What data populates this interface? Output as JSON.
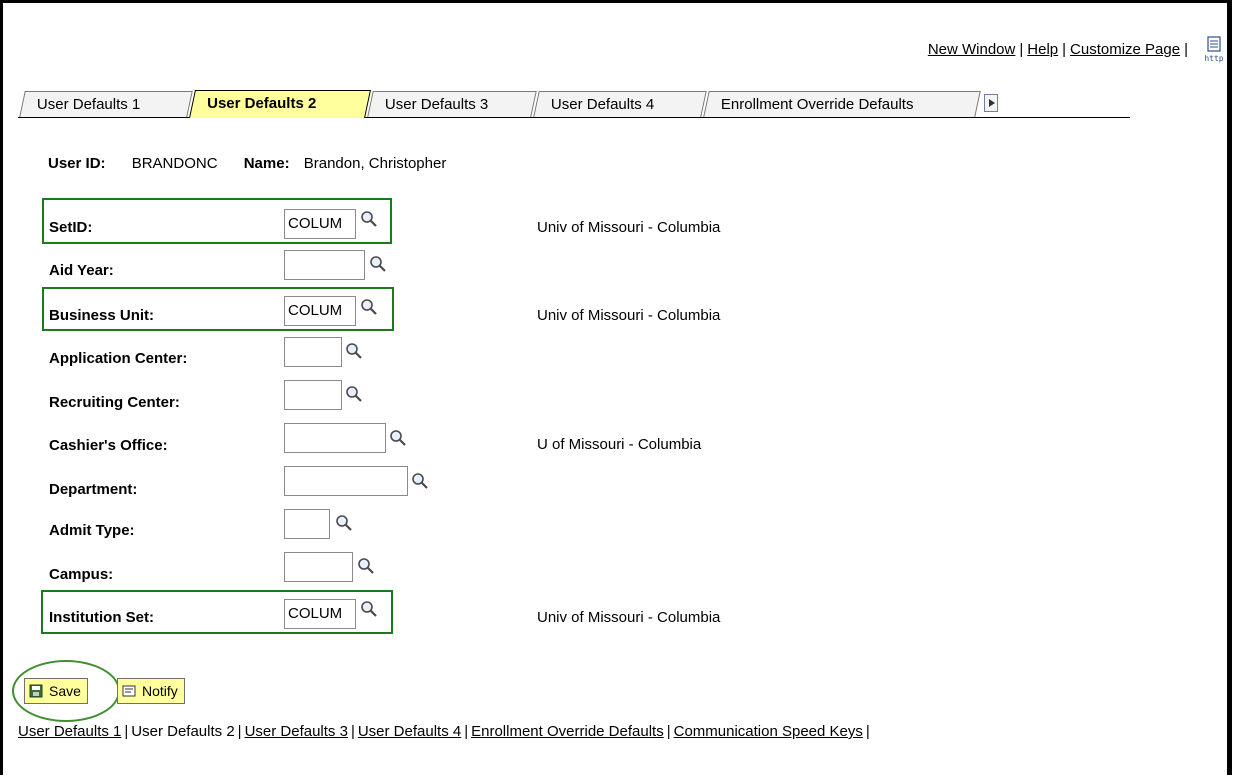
{
  "header_links": {
    "new_window": "New Window",
    "help": "Help",
    "customize_page": "Customize Page",
    "separator": "|"
  },
  "tabs": [
    {
      "label": "User Defaults 1",
      "active": false
    },
    {
      "label": "User Defaults 2",
      "active": true
    },
    {
      "label": "User Defaults 3",
      "active": false
    },
    {
      "label": "User Defaults 4",
      "active": false
    },
    {
      "label": "Enrollment Override Defaults",
      "active": false
    }
  ],
  "user": {
    "id_label": "User ID:",
    "id_value": "BRANDONC",
    "name_label": "Name:",
    "name_value": "Brandon, Christopher"
  },
  "form": {
    "setid": {
      "label": "SetID:",
      "value": "COLUM",
      "description": "Univ of Missouri - Columbia"
    },
    "aid_year": {
      "label": "Aid Year:",
      "value": ""
    },
    "business_unit": {
      "label": "Business Unit:",
      "value": "COLUM",
      "description": "Univ of Missouri - Columbia"
    },
    "application_center": {
      "label": "Application Center:",
      "value": ""
    },
    "recruiting_center": {
      "label": "Recruiting Center:",
      "value": ""
    },
    "cashiers_office": {
      "label": "Cashier's Office:",
      "value": "",
      "description": "U of Missouri - Columbia"
    },
    "department": {
      "label": "Department:",
      "value": ""
    },
    "admit_type": {
      "label": "Admit Type:",
      "value": ""
    },
    "campus": {
      "label": "Campus:",
      "value": ""
    },
    "institution_set": {
      "label": "Institution Set:",
      "value": "COLUM",
      "description": "Univ of Missouri - Columbia"
    }
  },
  "buttons": {
    "save": "Save",
    "notify": "Notify"
  },
  "bottom_links": [
    "User Defaults 1",
    "User Defaults 2",
    "User Defaults 3",
    "User Defaults 4",
    "Enrollment Override Defaults",
    "Communication Speed Keys"
  ],
  "colors": {
    "active_tab": "#ffff9c",
    "highlight_box": "#1b7a1b",
    "button_bg": "#ffff9c"
  },
  "icons": {
    "lookup": "magnifier-icon",
    "http": "http-page-icon",
    "save": "save-disk-icon",
    "notify": "notify-icon",
    "next_tab": "next-tab-icon"
  }
}
